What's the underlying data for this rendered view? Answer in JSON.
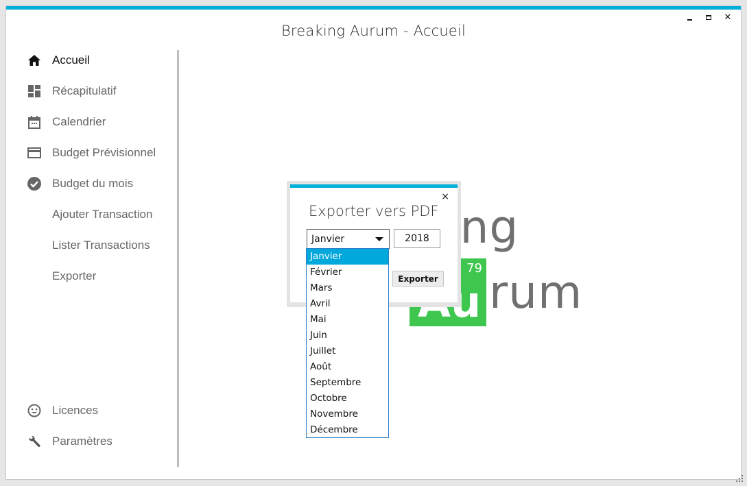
{
  "window": {
    "title": "Breaking Aurum - Accueil",
    "controls": {
      "minimize": "minimize",
      "maximize": "maximize",
      "close": "close"
    },
    "accent_color": "#00b0d8"
  },
  "sidebar": {
    "items": [
      {
        "label": "Accueil",
        "icon": "home-icon",
        "active": true
      },
      {
        "label": "Récapitulatif",
        "icon": "dashboard-icon",
        "active": false
      },
      {
        "label": "Calendrier",
        "icon": "calendar-icon",
        "active": false
      },
      {
        "label": "Budget Prévisionnel",
        "icon": "credit-card-icon",
        "active": false
      },
      {
        "label": "Budget du mois",
        "icon": "check-circle-icon",
        "active": false
      },
      {
        "label": "Ajouter Transaction",
        "icon": null,
        "active": false
      },
      {
        "label": "Lister Transactions",
        "icon": null,
        "active": false
      },
      {
        "label": "Exporter",
        "icon": null,
        "active": false
      }
    ],
    "bottom_items": [
      {
        "label": "Licences",
        "icon": "smiley-icon"
      },
      {
        "label": "Paramètres",
        "icon": "wrench-icon"
      }
    ]
  },
  "logo": {
    "line1": "Breaking",
    "line2_rest": "rum",
    "element_symbol": "Au",
    "atomic_number": "79",
    "element_color": "#3fc64f"
  },
  "dialog": {
    "title": "Exporter vers PDF",
    "close": "×",
    "month_selected": "Janvier",
    "year_value": "2018",
    "export_button": "Exporter",
    "months": [
      "Janvier",
      "Février",
      "Mars",
      "Avril",
      "Mai",
      "Juin",
      "Juillet",
      "Août",
      "Septembre",
      "Octobre",
      "Novembre",
      "Décembre"
    ],
    "highlight_color": "#00a8dc"
  }
}
